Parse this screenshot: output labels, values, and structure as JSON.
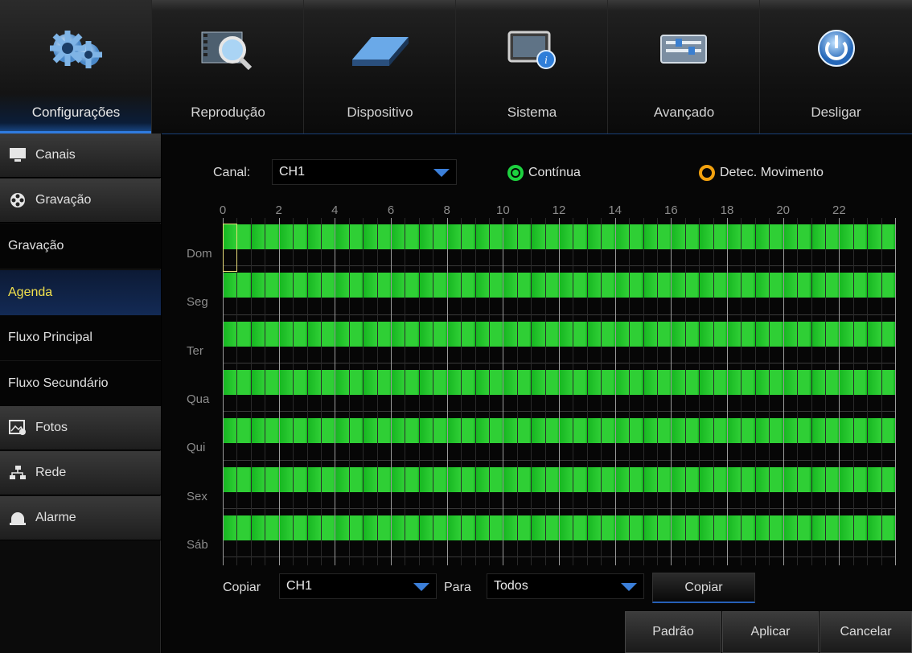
{
  "nav": {
    "items": [
      {
        "label": "Configurações",
        "icon": "gears-icon"
      },
      {
        "label": "Reprodução",
        "icon": "playback-search-icon"
      },
      {
        "label": "Dispositivo",
        "icon": "hard-drive-icon"
      },
      {
        "label": "Sistema",
        "icon": "system-info-icon"
      },
      {
        "label": "Avançado",
        "icon": "advanced-sliders-icon"
      },
      {
        "label": "Desligar",
        "icon": "power-icon"
      }
    ],
    "active_index": 0
  },
  "sidebar": {
    "groups": [
      {
        "label": "Canais",
        "icon": "monitor-icon"
      },
      {
        "label": "Gravação",
        "icon": "film-reel-icon"
      },
      {
        "label": "Fotos",
        "icon": "photo-icon"
      },
      {
        "label": "Rede",
        "icon": "network-icon"
      },
      {
        "label": "Alarme",
        "icon": "alarm-bell-icon"
      }
    ],
    "subitems": [
      "Gravação",
      "Agenda",
      "Fluxo Principal",
      "Fluxo Secundário"
    ],
    "active_subitem": "Agenda"
  },
  "schedule": {
    "channel_label": "Canal:",
    "channel_value": "CH1",
    "legend": [
      {
        "label": "Contínua",
        "color": "#1dd13f"
      },
      {
        "label": "Detec. Movimento",
        "color": "#f2a10e"
      }
    ],
    "hours": [
      "0",
      "2",
      "4",
      "6",
      "8",
      "10",
      "12",
      "14",
      "16",
      "18",
      "20",
      "22"
    ],
    "days": [
      "Dom",
      "Seg",
      "Ter",
      "Qua",
      "Qui",
      "Sex",
      "Sáb"
    ],
    "recording_mode_per_day": [
      "Contínua",
      "Contínua",
      "Contínua",
      "Contínua",
      "Contínua",
      "Contínua",
      "Contínua"
    ],
    "copy": {
      "label": "Copiar",
      "from_value": "CH1",
      "to_label": "Para",
      "to_value": "Todos",
      "button_label": "Copiar"
    }
  },
  "footer": {
    "default_label": "Padrão",
    "apply_label": "Aplicar",
    "cancel_label": "Cancelar"
  }
}
